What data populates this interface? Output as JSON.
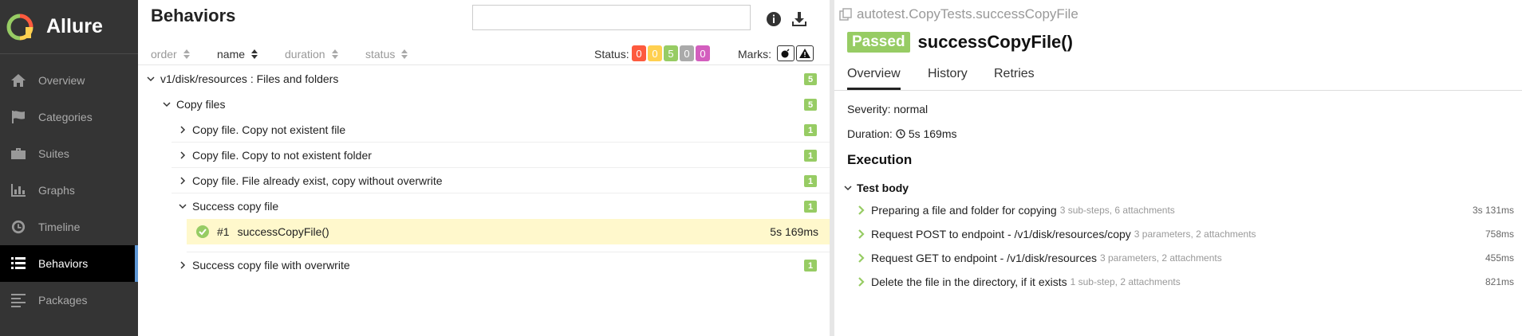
{
  "app": {
    "name": "Allure"
  },
  "sidebar": {
    "items": [
      {
        "label": "Overview",
        "icon": "home-icon"
      },
      {
        "label": "Categories",
        "icon": "flag-icon"
      },
      {
        "label": "Suites",
        "icon": "briefcase-icon"
      },
      {
        "label": "Graphs",
        "icon": "bar-chart-icon"
      },
      {
        "label": "Timeline",
        "icon": "clock-icon"
      },
      {
        "label": "Behaviors",
        "icon": "list-icon",
        "active": true
      },
      {
        "label": "Packages",
        "icon": "align-left-icon"
      }
    ]
  },
  "behaviors": {
    "title": "Behaviors",
    "search": {
      "value": "",
      "placeholder": ""
    },
    "sort": {
      "order": "order",
      "name": "name",
      "duration": "duration",
      "status": "status"
    },
    "status_label": "Status:",
    "status_counts": [
      {
        "value": "0",
        "color": "#fd5a3e"
      },
      {
        "value": "0",
        "color": "#ffd050"
      },
      {
        "value": "5",
        "color": "#97cc64"
      },
      {
        "value": "0",
        "color": "#aaaaaa"
      },
      {
        "value": "0",
        "color": "#d35ebe"
      }
    ],
    "marks_label": "Marks:",
    "tree": {
      "root": {
        "label": "v1/disk/resources : Files and folders",
        "count": "5"
      },
      "group": {
        "label": "Copy files",
        "count": "5"
      },
      "items": [
        {
          "label": "Copy file. Copy not existent file",
          "count": "1"
        },
        {
          "label": "Copy file. Copy to not existent folder",
          "count": "1"
        },
        {
          "label": "Copy file. File already exist, copy without overwrite",
          "count": "1"
        },
        {
          "label": "Success copy file",
          "count": "1"
        },
        {
          "label": "Success copy file with overwrite",
          "count": "1"
        }
      ],
      "selected_test": {
        "num": "#1",
        "name": "successCopyFile()",
        "duration": "5s 169ms"
      }
    }
  },
  "details": {
    "path": "autotest.CopyTests.successCopyFile",
    "status": "Passed",
    "title": "successCopyFile()",
    "tabs": [
      "Overview",
      "History",
      "Retries"
    ],
    "severity": "Severity: normal",
    "duration_label": "Duration:",
    "duration": "5s 169ms",
    "execution_title": "Execution",
    "test_body_label": "Test body",
    "steps": [
      {
        "name": "Preparing a file and folder for copying",
        "meta": "3 sub-steps, 6 attachments",
        "duration": "3s 131ms"
      },
      {
        "name": "Request POST to endpoint - /v1/disk/resources/copy",
        "meta": "3 parameters, 2 attachments",
        "duration": "758ms"
      },
      {
        "name": "Request GET to endpoint - /v1/disk/resources",
        "meta": "3 parameters, 2 attachments",
        "duration": "455ms"
      },
      {
        "name": "Delete the file in the directory, if it exists",
        "meta": "1 sub-step, 2 attachments",
        "duration": "821ms"
      }
    ]
  }
}
